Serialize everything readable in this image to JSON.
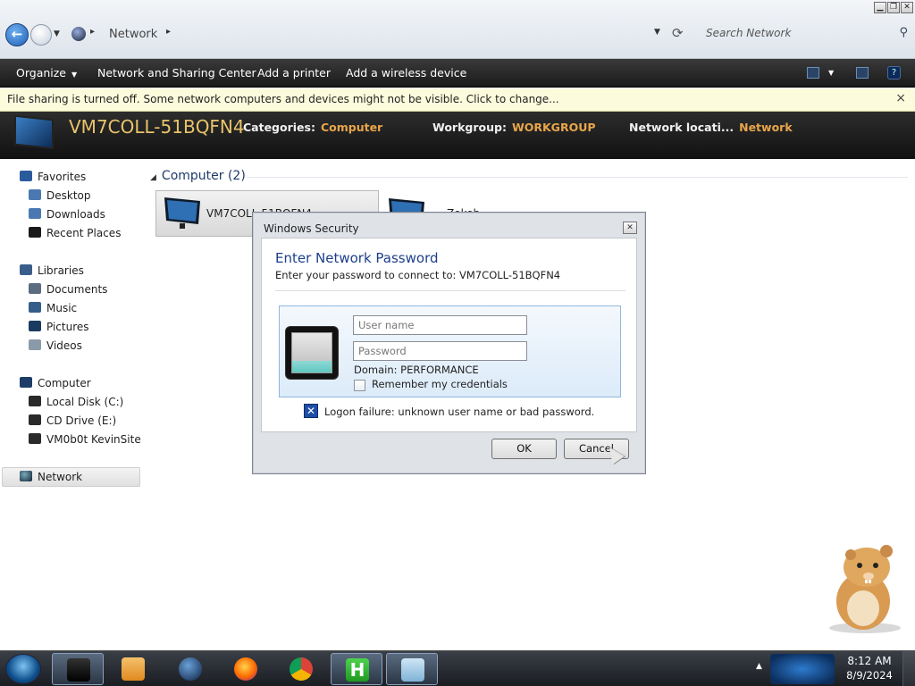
{
  "window": {
    "caption": {
      "minimize": "▁",
      "restore": "❐",
      "close": "✕"
    }
  },
  "address_bar": {
    "location": "Network",
    "search_placeholder": "Search Network"
  },
  "command_bar": {
    "organize": "Organize",
    "network_sharing_center": "Network and Sharing Center",
    "add_printer": "Add a printer",
    "add_wireless": "Add a wireless device"
  },
  "info_bar": {
    "text": "File sharing is turned off. Some network computers and devices might not be visible. Click to change...",
    "close": "×"
  },
  "details": {
    "computer_name": "VM7COLL-51BQFN4",
    "categories_label": "Categories:",
    "categories_value": "Computer",
    "workgroup_label": "Workgroup:",
    "workgroup_value": "WORKGROUP",
    "location_label": "Network locati...",
    "location_value": "Network"
  },
  "nav": {
    "favorites": "Favorites",
    "desktop": "Desktop",
    "downloads": "Downloads",
    "recent_places": "Recent Places",
    "libraries": "Libraries",
    "documents": "Documents",
    "music": "Music",
    "pictures": "Pictures",
    "videos": "Videos",
    "computer": "Computer",
    "local_disk": "Local Disk (C:)",
    "cd_drive": "CD Drive (E:)",
    "kevinsite": "VM0b0t KevinSite",
    "network": "Network"
  },
  "content": {
    "group_header": "Computer (2)",
    "tile1_label": "VM7COLL-51BQFN4",
    "tile2_label": "Zokeh..."
  },
  "dialog": {
    "title": "Windows Security",
    "close": "✕",
    "heading": "Enter Network Password",
    "subtitle": "Enter your password to connect to: VM7COLL-51BQFN4",
    "username_placeholder": "User name",
    "password_placeholder": "Password",
    "domain": "Domain: PERFORMANCE",
    "remember": "Remember my credentials",
    "error_icon": "✕",
    "error": "Logon failure: unknown user name or bad password.",
    "ok": "OK",
    "cancel": "Cancel"
  },
  "taskbar": {
    "time": "8:12 AM",
    "date": "8/9/2024",
    "tray_arrow": "▲"
  },
  "colors": {
    "accent_heading": "#1d3f8a",
    "details_name": "#e9c46a",
    "details_value": "#e8a64a",
    "infobar_bg": "#fcfcdd"
  }
}
